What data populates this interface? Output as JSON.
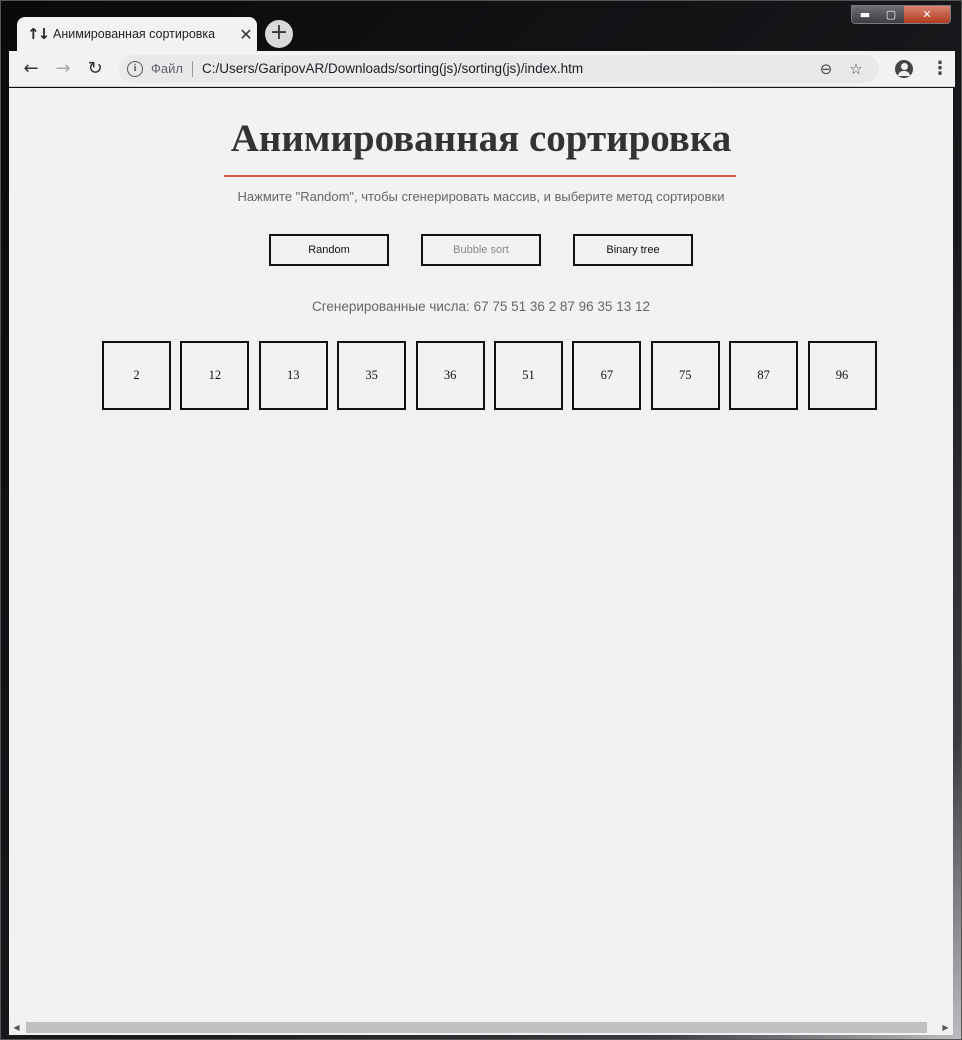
{
  "browser": {
    "tab_icon": "↑↓",
    "tab_title": "Анимированная сортировка",
    "tab_close": "✕",
    "new_tab": "+",
    "controls": {
      "minimize": "▬",
      "maximize": "▢",
      "close": "✕"
    },
    "nav": {
      "back": "←",
      "forward": "→",
      "reload": "↻"
    },
    "address": {
      "info": "i",
      "scheme_label": "Файл",
      "url": "C:/Users/GaripovAR/Downloads/sorting(js)/sorting(js)/index.htm",
      "zoom": "⊖",
      "bookmark": "☆"
    },
    "menu": "⋮"
  },
  "page": {
    "title": "Анимированная сортировка",
    "subtitle": "Нажмите \"Random\", чтобы сгенерировать массив, и выберите метод сортировки",
    "buttons": [
      {
        "label": "Random",
        "enabled": true
      },
      {
        "label": "Bubble sort",
        "enabled": false
      },
      {
        "label": "Binary tree",
        "enabled": true
      }
    ],
    "generated_label": "Сгенерированные числа:",
    "generated_values": "67 75 51 36 2 87 96 35 13 12",
    "sorted_boxes": [
      "2",
      "12",
      "13",
      "35",
      "36",
      "51",
      "67",
      "75",
      "87",
      "96"
    ]
  },
  "colors": {
    "accent_line": "#d35a46",
    "page_bg": "#f2f2f2"
  },
  "scrollbar": {
    "left_arrow": "◀",
    "right_arrow": "▶"
  }
}
